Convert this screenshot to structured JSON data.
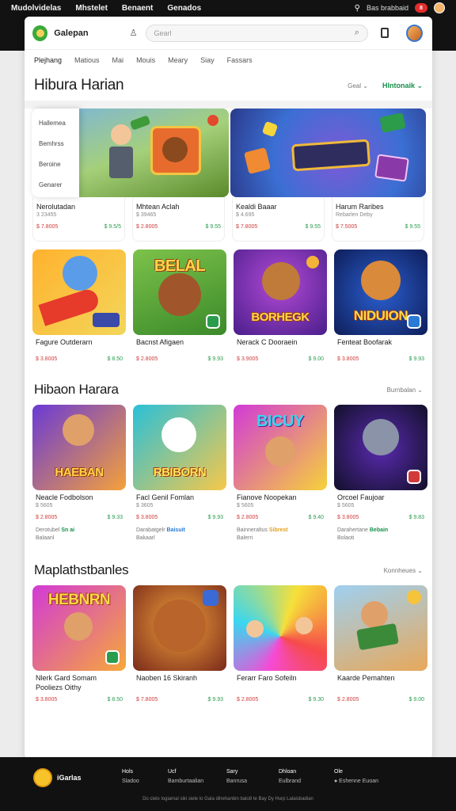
{
  "topbar": {
    "links": [
      "Mudolvidelas",
      "Mhstelet",
      "Benaent",
      "Genados"
    ],
    "right_text": "Bas brabbaid",
    "badge": "8"
  },
  "header": {
    "brand": "Galepan",
    "search_placeholder": "Gearl"
  },
  "nav": [
    "Plejhang",
    "Matious",
    "Mai",
    "Mouis",
    "Meary",
    "Siay",
    "Fassars"
  ],
  "section1": {
    "title": "Hibura Harian",
    "control": "Geal ⌄",
    "control2": "Hlntonaik ⌄",
    "categories": [
      "Hallemea",
      "Bemhrss",
      "Beroine",
      "Genarer"
    ]
  },
  "row1": [
    {
      "name": "Nerolutadan",
      "sub": "3 23455",
      "p1": "$ 7.8005",
      "p2": "$ 9.5/5"
    },
    {
      "name": "Mhtean Aclah",
      "sub": "$ 39465",
      "p1": "$ 2.8005",
      "p2": "$ 9.55"
    },
    {
      "name": "Kealdi Baaar",
      "sub": "$ 4.695",
      "p1": "$ 7.8005",
      "p2": "$ 9.55"
    },
    {
      "name": "Harum Raribes",
      "sub": "Rebarlen Deby",
      "p1": "$ 7.5005",
      "p2": "$ 9.55"
    }
  ],
  "row2": [
    {
      "name": "Fagure Outderarn",
      "sub": "",
      "p1": "$ 3.8005",
      "p2": "$ 8.50",
      "logo": ""
    },
    {
      "name": "Bacnst Afigaen",
      "sub": "",
      "p1": "$ 2.8005",
      "p2": "$ 9.93",
      "logo": "BELAL"
    },
    {
      "name": "Nerack C Dooraein",
      "sub": "",
      "p1": "$ 3.9005",
      "p2": "$ 9.00",
      "logo": "BORHEGK"
    },
    {
      "name": "Fenteat Boofarak",
      "sub": "",
      "p1": "$ 3.8005",
      "p2": "$ 9.93",
      "logo": "NIDUION"
    }
  ],
  "section2": {
    "title": "Hibaon Harara",
    "control": "Burnbalan ⌄"
  },
  "row3": [
    {
      "name": "Neacle Fodbolson",
      "sub": "$ 5605",
      "p1": "$ 2.8005",
      "p2": "$ 9.33",
      "meta1": "Derotubel",
      "meta2": "Sn ai",
      "meta3": "Balaanl",
      "logo": "HAEBAN"
    },
    {
      "name": "Facl Genil Fomlan",
      "sub": "$ 3605",
      "p1": "$ 3.8005",
      "p2": "$ 9.93",
      "meta1": "Darabatgelr",
      "meta2": "Baisuit",
      "meta3": "Bakaarl",
      "logo": "RBIBORN"
    },
    {
      "name": "Fianove Noopekan",
      "sub": "$ 5605",
      "p1": "$ 2.8005",
      "p2": "$ 9.40",
      "meta1": "Bainneraltus",
      "meta2": "Sibrest",
      "meta3": "Balerri",
      "logo": "BICUY"
    },
    {
      "name": "Orcoel Faujoar",
      "sub": "$ 5605",
      "p1": "$ 3.8005",
      "p2": "$ 9.83",
      "meta1": "Darahertane",
      "meta2": "Bebain",
      "meta3": "Bolaoti",
      "logo": ""
    }
  ],
  "section3": {
    "title": "Maplathstbanles",
    "control": "Konnheues ⌄"
  },
  "row4": [
    {
      "name": "Nlerk Gard Somam",
      "sub": "Pooliezs Oithy",
      "p1": "$ 3.8005",
      "p2": "$ 8.50",
      "logo": "HEBNRN"
    },
    {
      "name": "Naoben 16 Skiranh",
      "sub": "",
      "p1": "$ 7.8005",
      "p2": "$ 9.93",
      "logo": ""
    },
    {
      "name": "Ferarr Faro Sofeiln",
      "sub": "",
      "p1": "$ 2.8005",
      "p2": "$ 9.30",
      "logo": ""
    },
    {
      "name": "Kaarde Pemahten",
      "sub": "",
      "p1": "$ 2.8005",
      "p2": "$ 9.00",
      "logo": ""
    }
  ],
  "footer": {
    "brand": "iGarlas",
    "cols": [
      [
        "Hols",
        "Sladoo"
      ],
      [
        "Ucf",
        "Bamburtaalian"
      ],
      [
        "Sary",
        "Banrusa"
      ],
      [
        "Dhloan",
        "Eulbrand"
      ],
      [
        "Ole",
        "● Eshenne Euoan"
      ]
    ],
    "copyright": "Do clelo logiamal siki siele lo Gala dilrehanbin balo8 te Bay Dy Hurp Lalaisbadian"
  },
  "colors": {
    "accent_green": "#16904a",
    "price_red": "#d23c3c",
    "price_green": "#2a9c4e",
    "bg_dark": "#121212"
  }
}
